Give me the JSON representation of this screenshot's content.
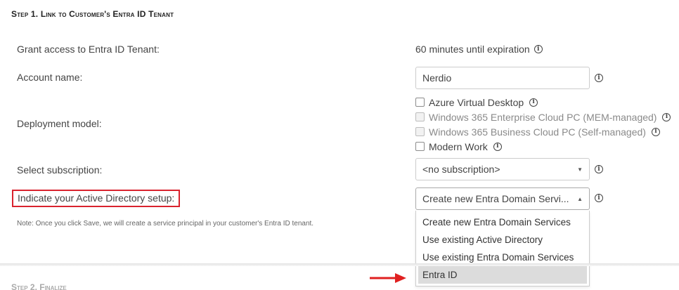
{
  "step1": {
    "title": "Step 1. Link to Customer's Entra ID Tenant"
  },
  "grant": {
    "label": "Grant access to Entra ID Tenant:",
    "value": "60 minutes until expiration"
  },
  "account": {
    "label": "Account name:",
    "value": "Nerdio"
  },
  "deployment": {
    "label": "Deployment model:",
    "options": [
      {
        "label": "Azure Virtual Desktop",
        "checked": false,
        "enabled": true
      },
      {
        "label": "Windows 365 Enterprise Cloud PC (MEM-managed)",
        "checked": false,
        "enabled": false
      },
      {
        "label": "Windows 365 Business Cloud PC (Self-managed)",
        "checked": false,
        "enabled": false
      },
      {
        "label": "Modern Work",
        "checked": false,
        "enabled": true
      }
    ]
  },
  "subscription": {
    "label": "Select subscription:",
    "selected": "<no subscription>"
  },
  "ad_setup": {
    "label": "Indicate your Active Directory setup:",
    "selected": "Create new Entra Domain Servi...",
    "options": [
      "Create new Entra Domain Services",
      "Use existing Active Directory",
      "Use existing Entra Domain Services",
      "Entra ID"
    ],
    "highlighted": "Entra ID"
  },
  "note": "Note: Once you click Save, we will create a service principal in your customer's Entra ID tenant.",
  "step2": {
    "title": "Step 2. Finalize"
  },
  "colors": {
    "highlight_border": "#d9232e",
    "arrow": "#e02020"
  }
}
